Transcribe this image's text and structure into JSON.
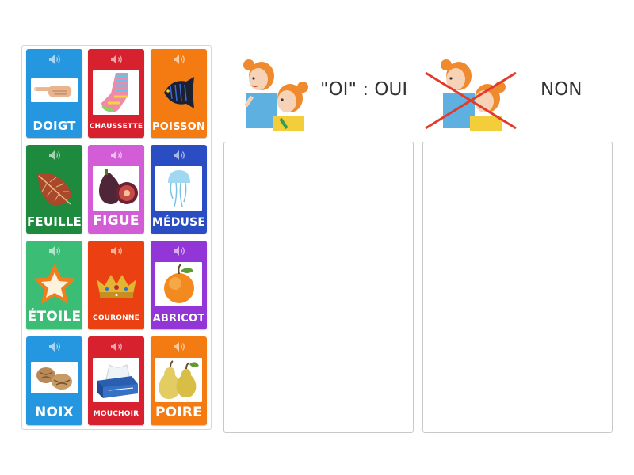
{
  "tray": {
    "cards": [
      {
        "label": "DOIGT",
        "picture": "pointing-finger",
        "color": "#2596e0"
      },
      {
        "label": "CHAUSSETTE",
        "picture": "striped-sock",
        "color": "#d7212f"
      },
      {
        "label": "POISSON",
        "picture": "fish",
        "color": "#f37b12"
      },
      {
        "label": "FEUILLE",
        "picture": "autumn-leaf",
        "color": "#1e8a3d"
      },
      {
        "label": "FIGUE",
        "picture": "figs",
        "color": "#d25dd7"
      },
      {
        "label": "MÉDUSE",
        "picture": "jellyfish",
        "color": "#2a4dc3"
      },
      {
        "label": "ÉTOILE",
        "picture": "star",
        "color": "#3bbd76"
      },
      {
        "label": "COURONNE",
        "picture": "crown",
        "color": "#eb4112"
      },
      {
        "label": "ABRICOT",
        "picture": "apricot",
        "color": "#9336d8"
      },
      {
        "label": "NOIX",
        "picture": "walnuts",
        "color": "#2596e0"
      },
      {
        "label": "MOUCHOIR",
        "picture": "tissue-box",
        "color": "#d7212f"
      },
      {
        "label": "POIRE",
        "picture": "pears",
        "color": "#f37b12"
      }
    ]
  },
  "groups": {
    "yes": {
      "label": "\"OI\" : OUI",
      "picture": "girls-whispering"
    },
    "no": {
      "label": "NON",
      "picture": "girls-whispering-crossed-out"
    }
  }
}
